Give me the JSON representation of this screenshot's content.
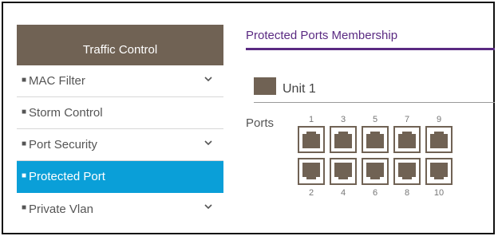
{
  "sidebar": {
    "header": "Traffic Control",
    "items": [
      {
        "label": "MAC Filter",
        "has_chevron": true,
        "active": false
      },
      {
        "label": "Storm Control",
        "has_chevron": false,
        "active": false
      },
      {
        "label": "Port Security",
        "has_chevron": true,
        "active": false
      },
      {
        "label": "Protected Port",
        "has_chevron": false,
        "active": true
      },
      {
        "label": "Private Vlan",
        "has_chevron": true,
        "active": false
      }
    ]
  },
  "main": {
    "title": "Protected Ports Membership",
    "unit_label": "Unit 1",
    "ports_label": "Ports",
    "top_port_numbers": [
      "1",
      "3",
      "5",
      "7",
      "9"
    ],
    "bottom_port_numbers": [
      "2",
      "4",
      "6",
      "8",
      "10"
    ]
  },
  "colors": {
    "sidebar_header_bg": "#706254",
    "active_item_bg": "#0a9fd8",
    "title_purple": "#5a2a82",
    "port_color": "#706254"
  },
  "icons": {
    "bullet": "•",
    "chevron": "chevron-down-icon",
    "port": "ethernet-port-icon",
    "unit": "unit-square-icon"
  }
}
